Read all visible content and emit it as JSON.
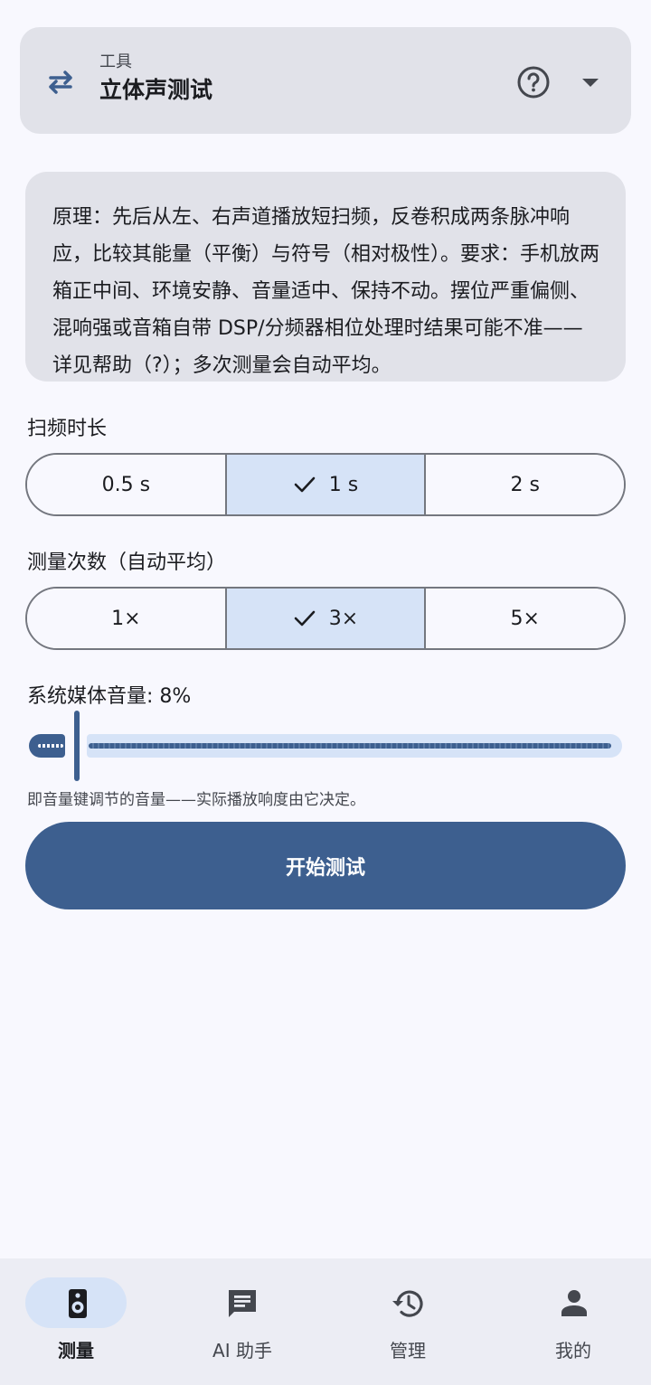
{
  "header": {
    "subtitle": "工具",
    "title": "立体声测试"
  },
  "info": {
    "text": "原理：先后从左、右声道播放短扫频，反卷积成两条脉冲响应，比较其能量（平衡）与符号（相对极性）。要求：手机放两箱正中间、环境安静、音量适中、保持不动。摆位严重偏侧、混响强或音箱自带 DSP/分频器相位处理时结果可能不准——详见帮助（?）；多次测量会自动平均。"
  },
  "sweep": {
    "label": "扫频时长",
    "options": [
      "0.5 s",
      "1 s",
      "2 s"
    ],
    "selected": "1 s"
  },
  "count": {
    "label": "测量次数（自动平均）",
    "options": [
      "1×",
      "3×",
      "5×"
    ],
    "selected": "3×"
  },
  "volume": {
    "label": "系统媒体音量: 8%",
    "value_percent": 8,
    "hint": "即音量键调节的音量——实际播放响度由它决定。"
  },
  "start_button": "开始测试",
  "nav": {
    "items": [
      {
        "label": "测量",
        "icon": "speaker-icon",
        "active": true
      },
      {
        "label": "AI 助手",
        "icon": "chat-icon",
        "active": false
      },
      {
        "label": "管理",
        "icon": "history-icon",
        "active": false
      },
      {
        "label": "我的",
        "icon": "person-icon",
        "active": false
      }
    ]
  },
  "colors": {
    "primary": "#3d5f8f",
    "selected_segment": "#d6e3f7",
    "card_bg": "#e1e2e9",
    "page_bg": "#f8f8fe"
  }
}
